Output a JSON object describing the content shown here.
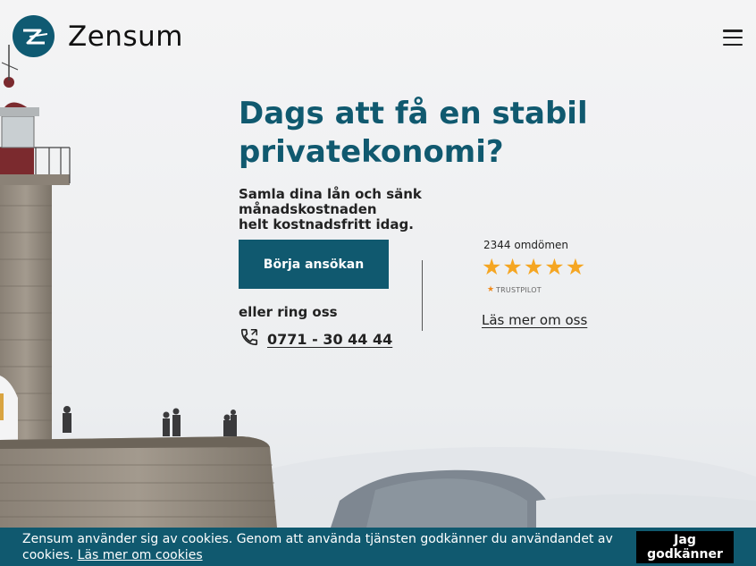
{
  "header": {
    "brand": "Zensum",
    "menu_icon": "hamburger-menu-icon",
    "logo_icon": "zensum-logo-icon"
  },
  "hero": {
    "title_line1": "Dags att få en stabil",
    "title_line2": "privatekonomi?",
    "subtitle_line1": "Samla dina lån och sänk månadskostnaden",
    "subtitle_line2": "helt kostnadsfritt idag.",
    "cta_label": "Börja ansökan",
    "or_call": "eller ring oss",
    "phone_icon": "phone-icon",
    "phone": "0771 - 30 44 44"
  },
  "reviews": {
    "count_label": "2344 omdömen",
    "stars": [
      "★",
      "★",
      "★",
      "★",
      "★"
    ],
    "rating_stars": 5,
    "trustpilot_label": "TRUSTPILOT",
    "about_link": "Läs mer om oss"
  },
  "cookie": {
    "text": "Zensum använder sig av cookies. Genom att använda tjänsten godkänner du användandet av cookies.",
    "link": "Läs mer om cookies",
    "accept_line1": "Jag",
    "accept_line2": "godkänner"
  },
  "colors": {
    "brand": "#10596f",
    "star": "#f5a623",
    "cookie_bar": "#10596f"
  }
}
